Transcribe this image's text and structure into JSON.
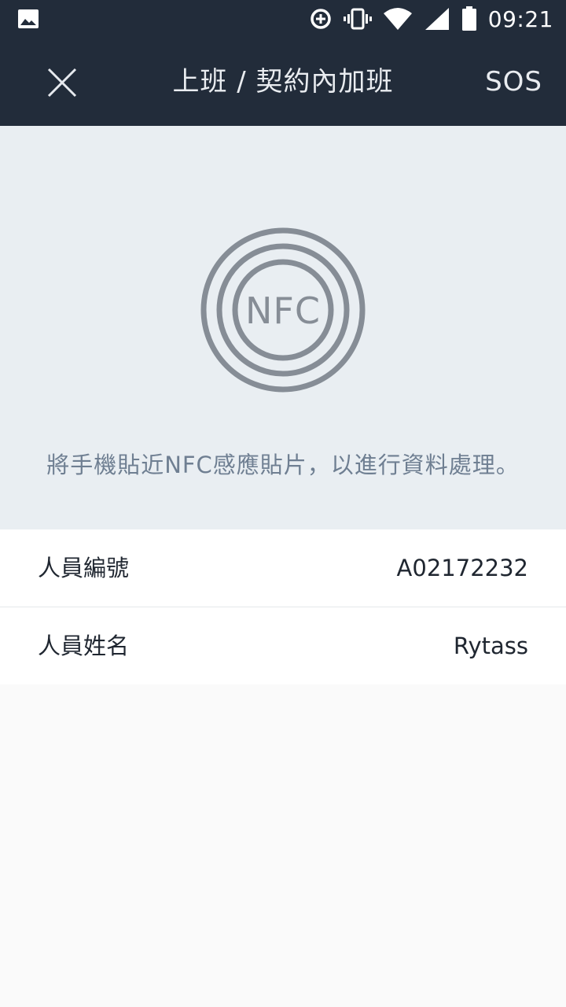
{
  "status_bar": {
    "time": "09:21",
    "icons": [
      "gallery-icon",
      "data-saver-icon",
      "vibrate-icon",
      "wifi-icon",
      "signal-icon",
      "battery-icon"
    ]
  },
  "header": {
    "title": "上班 / 契約內加班",
    "close_icon": "close-icon",
    "sos_label": "SOS"
  },
  "nfc": {
    "icon_text": "NFC",
    "instruction": "將手機貼近NFC感應貼片，以進行資料處理。"
  },
  "employee": {
    "rows": [
      {
        "label": "人員編號",
        "value": "A02172232"
      },
      {
        "label": "人員姓名",
        "value": "Rytass"
      }
    ]
  },
  "colors": {
    "header_bg": "#222c3a",
    "panel_bg": "#e9eef2",
    "nfc_gray": "#868d96",
    "instruction_text": "#6f7f92"
  }
}
